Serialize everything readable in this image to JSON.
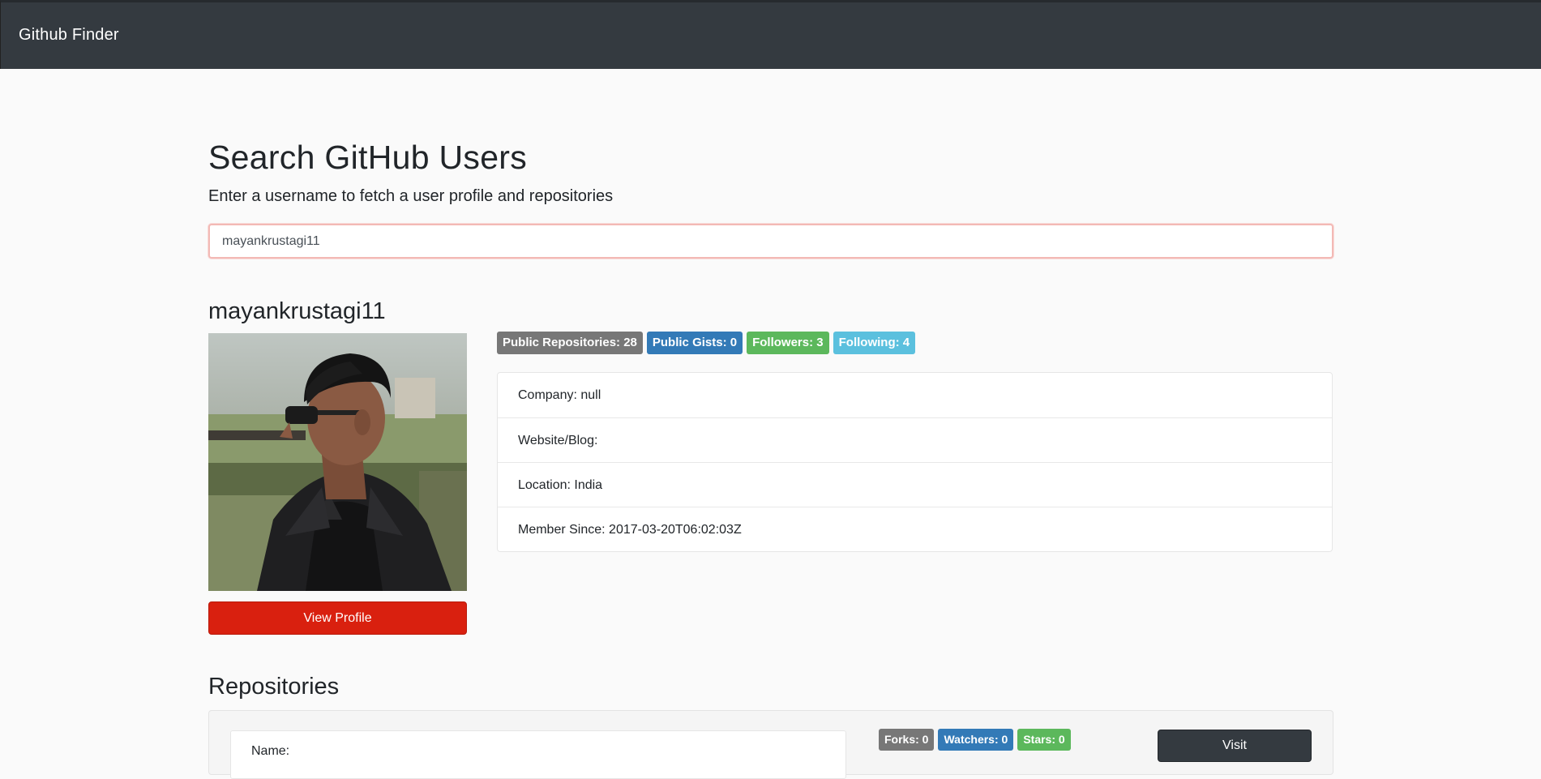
{
  "navbar": {
    "brand": "Github Finder"
  },
  "search": {
    "title": "Search GitHub Users",
    "subtitle": "Enter a username to fetch a user profile and repositories",
    "value": "mayankrustagi11"
  },
  "profile": {
    "username": "mayankrustagi11",
    "view_profile_label": "View Profile",
    "badges": [
      {
        "label": "Public Repositories: 28",
        "color": "#777777"
      },
      {
        "label": "Public Gists: 0",
        "color": "#337ab7"
      },
      {
        "label": "Followers: 3",
        "color": "#5cb85c"
      },
      {
        "label": "Following: 4",
        "color": "#5bc0de"
      }
    ],
    "details": [
      {
        "text": "Company: null"
      },
      {
        "text": "Website/Blog:"
      },
      {
        "text": "Location: India"
      },
      {
        "text": "Member Since: 2017-03-20T06:02:03Z"
      }
    ]
  },
  "repositories": {
    "title": "Repositories",
    "items": [
      {
        "name_label": "Name:",
        "forks": "Forks: 0",
        "watchers": "Watchers: 0",
        "stars": "Stars: 0",
        "visit_label": "Visit"
      }
    ]
  },
  "colors": {
    "navbar_bg": "#343a40",
    "danger": "#d9200f",
    "dark_button": "#343a40",
    "badge_default": "#777777",
    "badge_primary": "#337ab7",
    "badge_success": "#5cb85c",
    "badge_info": "#5bc0de"
  }
}
